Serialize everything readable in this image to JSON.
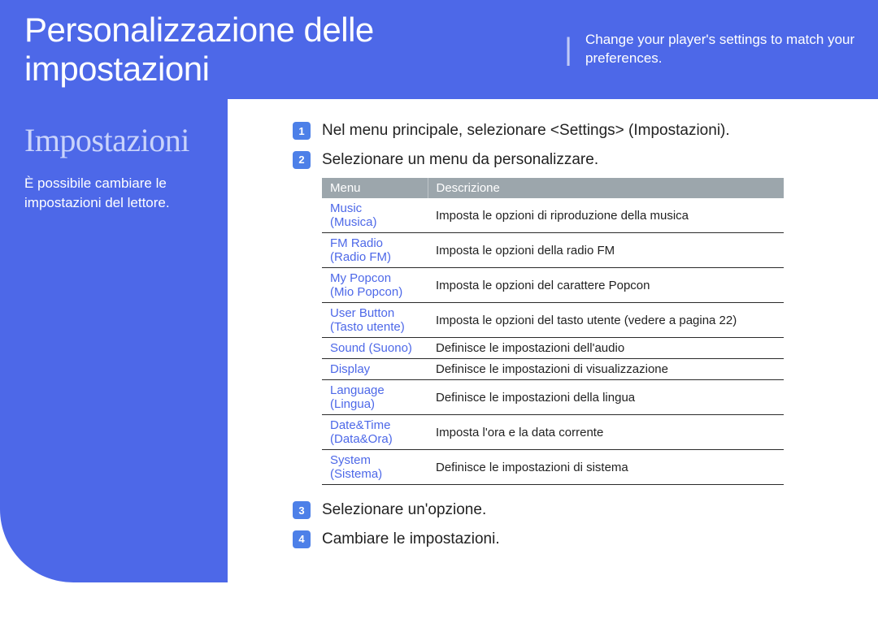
{
  "header": {
    "title": "Personalizzazione delle impostazioni",
    "subtitle": "Change your player's settings to match your preferences."
  },
  "sidebar": {
    "title": "Impostazioni",
    "description": "È possibile cambiare le impostazioni del lettore."
  },
  "steps": [
    {
      "num": "1",
      "text": "Nel menu principale, selezionare <Settings> (Impostazioni)."
    },
    {
      "num": "2",
      "text": "Selezionare un menu da personalizzare."
    },
    {
      "num": "3",
      "text": "Selezionare un'opzione."
    },
    {
      "num": "4",
      "text": "Cambiare le impostazioni."
    }
  ],
  "table": {
    "headers": {
      "menu": "Menu",
      "desc": "Descrizione"
    },
    "rows": [
      {
        "menu1": "Music",
        "menu2": "(Musica)",
        "desc": "Imposta le opzioni di riproduzione della musica"
      },
      {
        "menu1": "FM Radio",
        "menu2": "(Radio FM)",
        "desc": "Imposta le opzioni della radio FM"
      },
      {
        "menu1": "My Popcon",
        "menu2": "(Mio Popcon)",
        "desc": "Imposta le opzioni del carattere Popcon"
      },
      {
        "menu1": "User Button",
        "menu2": "(Tasto utente)",
        "desc": "Imposta le opzioni del tasto utente (vedere a pagina 22)"
      },
      {
        "menu1": "Sound (Suono)",
        "menu2": "",
        "desc": "Definisce le impostazioni dell'audio"
      },
      {
        "menu1": "Display",
        "menu2": "",
        "desc": "Definisce le impostazioni di visualizzazione"
      },
      {
        "menu1": "Language",
        "menu2": "(Lingua)",
        "desc": "Definisce le impostazioni della lingua"
      },
      {
        "menu1": "Date&Time",
        "menu2": "(Data&Ora)",
        "desc": "Imposta l'ora e la data corrente"
      },
      {
        "menu1": "System",
        "menu2": "(Sistema)",
        "desc": "Definisce le impostazioni di sistema"
      }
    ]
  }
}
